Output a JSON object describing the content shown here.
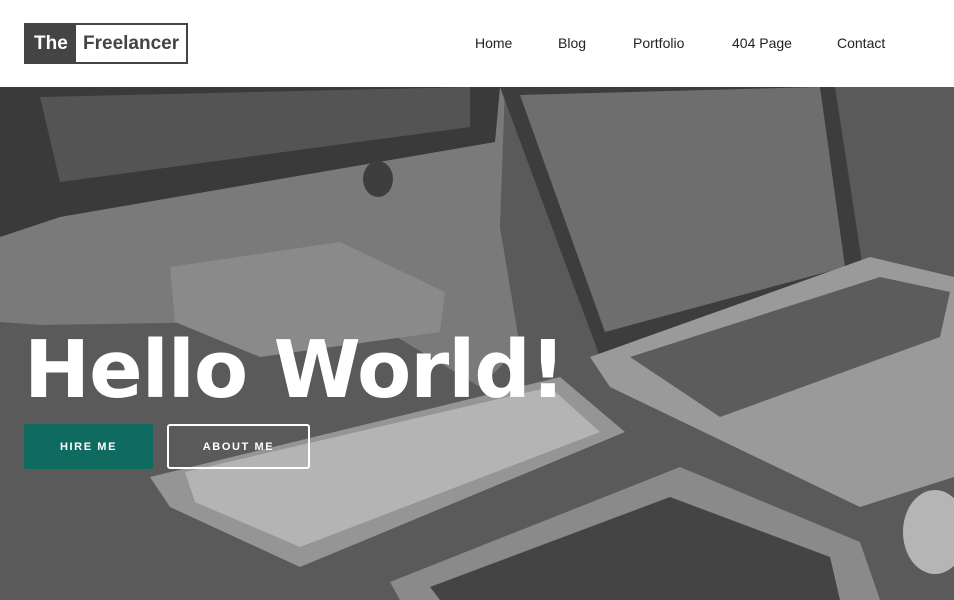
{
  "logo": {
    "part1": "The",
    "part2": "Freelancer"
  },
  "nav": {
    "items": [
      {
        "label": "Home"
      },
      {
        "label": "Blog"
      },
      {
        "label": "Portfolio"
      },
      {
        "label": "404 Page"
      },
      {
        "label": "Contact"
      }
    ]
  },
  "hero": {
    "title": "Hello World!",
    "primary_button": "HIRE ME",
    "secondary_button": "ABOUT ME"
  },
  "colors": {
    "primary_button_bg": "#0f6b5f",
    "logo_dark": "#444444",
    "overlay": "#5e5e5e"
  }
}
